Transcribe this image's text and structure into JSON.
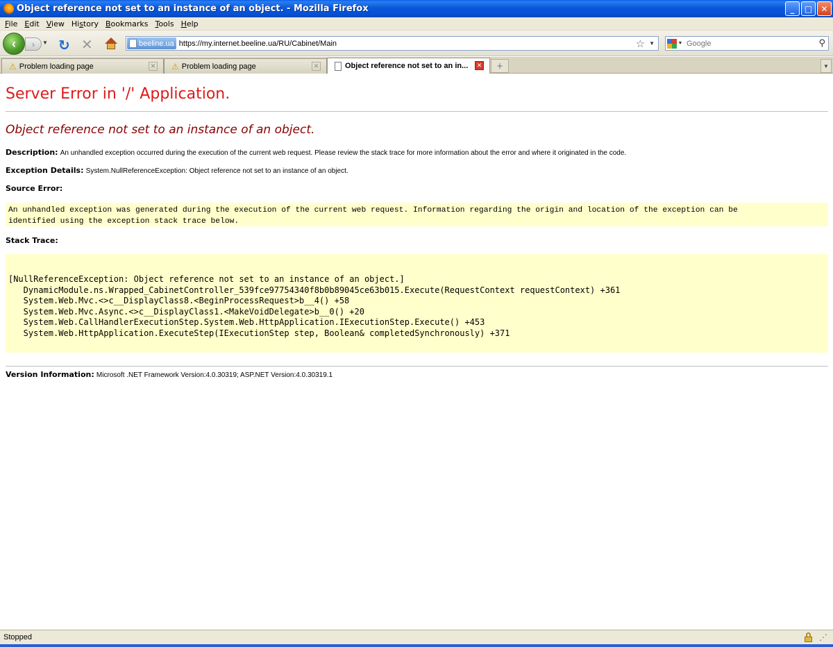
{
  "window": {
    "title": "Object reference not set to an instance of an object. - Mozilla Firefox",
    "minimize": "_",
    "maximize": "□",
    "close": "✕"
  },
  "menu": {
    "items": [
      {
        "accel": "F",
        "rest": "ile"
      },
      {
        "accel": "E",
        "rest": "dit"
      },
      {
        "accel": "V",
        "rest": "iew"
      },
      {
        "accel": "",
        "pre": "Hi",
        "mid": "s",
        "rest": "tory"
      },
      {
        "accel": "B",
        "rest": "ookmarks"
      },
      {
        "accel": "T",
        "rest": "ools"
      },
      {
        "accel": "H",
        "rest": "elp"
      }
    ]
  },
  "nav": {
    "site_identity": "beeline.ua",
    "url": "https://my.internet.beeline.ua/RU/Cabinet/Main",
    "search_placeholder": "Google"
  },
  "tabs": [
    {
      "label": "Problem loading page",
      "icon": "warning-icon",
      "active": false
    },
    {
      "label": "Problem loading page",
      "icon": "warning-icon",
      "active": false
    },
    {
      "label": "Object reference not set to an in...",
      "icon": "page-icon",
      "active": true
    }
  ],
  "page": {
    "heading": "Server Error in '/' Application.",
    "error_title": "Object reference not set to an instance of an object.",
    "description_label": "Description:",
    "description_text": "An unhandled exception occurred during the execution of the current web request. Please review the stack trace for more information about the error and where it originated in the code.",
    "exception_label": "Exception Details:",
    "exception_text": "System.NullReferenceException: Object reference not set to an instance of an object.",
    "source_error_label": "Source Error:",
    "source_error_line1": "An unhandled exception was generated during the execution of the current web request. Information regarding the origin and location of the exception can be",
    "source_error_line2": "identified using the exception stack trace below.",
    "stack_trace_label": "Stack Trace:",
    "stack_trace": "[NullReferenceException: Object reference not set to an instance of an object.]\n   DynamicModule.ns.Wrapped_CabinetController_539fce97754340f8b0b89045ce63b015.Execute(RequestContext requestContext) +361\n   System.Web.Mvc.<>c__DisplayClass8.<BeginProcessRequest>b__4() +58\n   System.Web.Mvc.Async.<>c__DisplayClass1.<MakeVoidDelegate>b__0() +20\n   System.Web.CallHandlerExecutionStep.System.Web.HttpApplication.IExecutionStep.Execute() +453\n   System.Web.HttpApplication.ExecuteStep(IExecutionStep step, Boolean& completedSynchronously) +371",
    "version_label": "Version Information:",
    "version_text": "Microsoft .NET Framework Version:4.0.30319; ASP.NET Version:4.0.30319.1"
  },
  "status": {
    "text": "Stopped"
  },
  "colors": {
    "heading_red": "#dd1a1a",
    "error_title_red": "#880000",
    "code_bg": "#ffffcc",
    "titlebar_blue": "#0b57d8"
  }
}
